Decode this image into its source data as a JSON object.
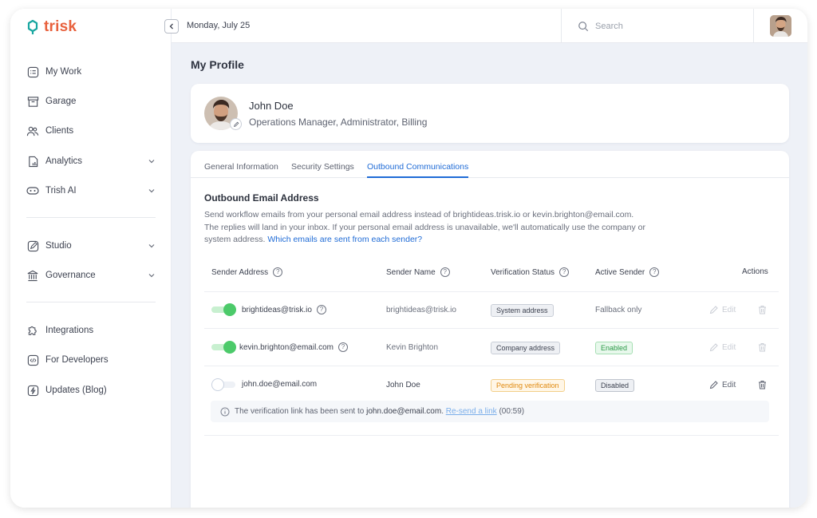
{
  "app": {
    "logo_text": "trisk",
    "brand_color": "#e8603c",
    "accent": "#1f6bd6"
  },
  "sidebar": {
    "items": [
      {
        "label": "My Work",
        "icon": "my-work-icon"
      },
      {
        "label": "Garage",
        "icon": "garage-icon"
      },
      {
        "label": "Clients",
        "icon": "clients-icon"
      },
      {
        "label": "Analytics",
        "icon": "analytics-icon"
      },
      {
        "label": "Trish AI",
        "icon": "trish-ai-icon"
      },
      {
        "label": "Studio",
        "icon": "studio-icon"
      },
      {
        "label": "Governance",
        "icon": "governance-icon"
      },
      {
        "label": "Integrations",
        "icon": "integrations-icon"
      },
      {
        "label": "For Developers",
        "icon": "developers-icon"
      },
      {
        "label": "Updates (Blog)",
        "icon": "updates-icon"
      }
    ]
  },
  "topbar": {
    "date": "Monday, July 25",
    "search_placeholder": "Search"
  },
  "page": {
    "title": "My Profile"
  },
  "profile": {
    "name": "John Doe",
    "role": "Operations Manager, Administrator, Billing"
  },
  "tabs": [
    {
      "label": "General Information",
      "active": false
    },
    {
      "label": "Security Settings",
      "active": false
    },
    {
      "label": "Outbound Communications",
      "active": true
    }
  ],
  "section": {
    "title": "Outbound Email Address",
    "desc_line1": "Send workflow emails from your personal email address instead of brightideas.trisk.io or kevin.brighton@email.com.",
    "desc_line2": "The replies will land in your inbox. If your personal email address is unavailable, we'll automatically use the company or",
    "desc_line3": "system address. ",
    "desc_link": "Which emails are sent from each sender?"
  },
  "table": {
    "headers": {
      "sender_address": "Sender Address",
      "sender_name": "Sender Name",
      "verification_status": "Verification Status",
      "active_sender": "Active Sender",
      "actions": "Actions"
    },
    "rows": [
      {
        "address": "brightideas@trisk.io",
        "name": "brightideas@trisk.io",
        "status": "System address",
        "active": "Fallback only",
        "toggle_on": true,
        "edit": "Edit"
      },
      {
        "address": "kevin.brighton@email.com",
        "name": "Kevin Brighton",
        "status": "Company address",
        "active": "Enabled",
        "toggle_on": true,
        "edit": "Edit"
      },
      {
        "address": "john.doe@email.com",
        "name": "John Doe",
        "status": "Pending verification",
        "active": "Disabled",
        "toggle_on": false,
        "edit": "Edit"
      }
    ]
  },
  "notice": {
    "prefix": "The verification link has been sent to ",
    "email": "john.doe@email.com",
    "sep": ". ",
    "link": "Re-send a link",
    "timer": " (00:59)"
  }
}
